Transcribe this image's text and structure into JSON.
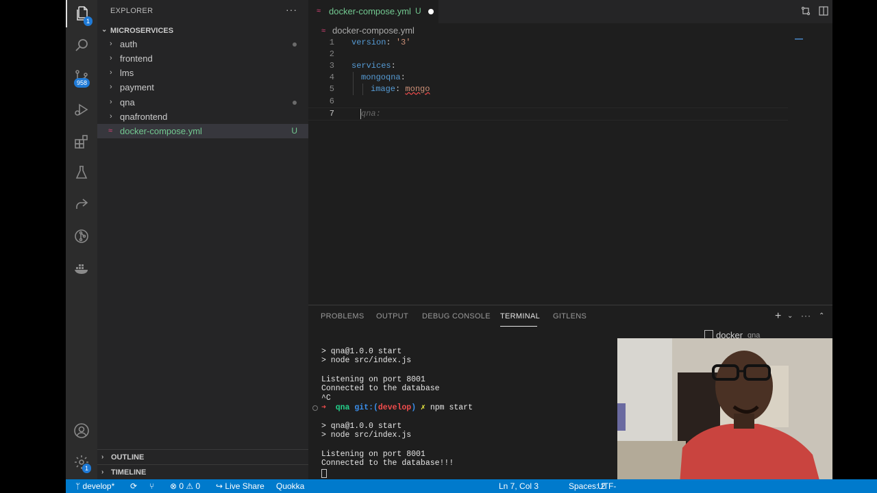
{
  "activity_bar": {
    "explorer_badge": "1",
    "source_control_badge": "958",
    "settings_badge": "1"
  },
  "sidebar": {
    "title": "EXPLORER",
    "more": "···",
    "folder": "MICROSERVICES",
    "items": [
      {
        "label": "auth",
        "modified": true
      },
      {
        "label": "frontend",
        "modified": false
      },
      {
        "label": "lms",
        "modified": false
      },
      {
        "label": "payment",
        "modified": false
      },
      {
        "label": "qna",
        "modified": true
      },
      {
        "label": "qnafrontend",
        "modified": false
      }
    ],
    "file": {
      "label": "docker-compose.yml",
      "status": "U"
    },
    "outline": "OUTLINE",
    "timeline": "TIMELINE"
  },
  "editor": {
    "tab": {
      "label": "docker-compose.yml",
      "status": "U"
    },
    "breadcrumb": "docker-compose.yml",
    "lines": [
      {
        "n": "1",
        "key": "version",
        "sep": ": ",
        "val": "'3'"
      },
      {
        "n": "2"
      },
      {
        "n": "3",
        "key": "services",
        "sep": ":"
      },
      {
        "n": "4",
        "key": "mongoqna",
        "sep": ":"
      },
      {
        "n": "5",
        "key": "image",
        "sep": ": ",
        "val": "mongo"
      },
      {
        "n": "6"
      },
      {
        "n": "7",
        "ghost": "qna:"
      }
    ]
  },
  "panel": {
    "tabs": [
      "PROBLEMS",
      "OUTPUT",
      "DEBUG CONSOLE",
      "TERMINAL",
      "GITLENS"
    ],
    "active_tab": "TERMINAL",
    "terminal_title": "docker",
    "terminal_subtitle": "qna",
    "terminal": {
      "l1": "> qna@1.0.0 start",
      "l2": "> node src/index.js",
      "l3": "Listening on port 8001",
      "l4": "Connected to the database",
      "l5": "^C",
      "prompt_arrow": "➜",
      "prompt_dir": "qna",
      "prompt_git": "git:(",
      "prompt_branch": "develop",
      "prompt_git_end": ")",
      "prompt_x": "✗",
      "prompt_cmd": "npm start",
      "l6": "> qna@1.0.0 start",
      "l7": "> node src/index.js",
      "l8": "Listening on port 8001",
      "l9": "Connected to the database!!!"
    }
  },
  "status_bar": {
    "branch": "develop*",
    "errors": "0",
    "warnings": "0",
    "live_share": "Live Share",
    "quokka": "Quokka",
    "position": "Ln 7, Col 3",
    "spaces": "Spaces: 2",
    "encoding": "UTF-"
  },
  "colors": {
    "accent": "#007acc",
    "git_untracked": "#73c991",
    "yaml_key": "#569cd6",
    "yaml_string": "#ce9178"
  }
}
